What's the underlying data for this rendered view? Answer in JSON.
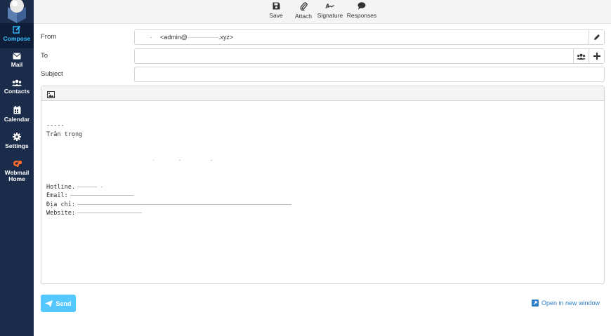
{
  "sidebar": {
    "items": [
      {
        "id": "compose",
        "label": "Compose",
        "icon": "compose-icon"
      },
      {
        "id": "mail",
        "label": "Mail",
        "icon": "envelope-icon"
      },
      {
        "id": "contacts",
        "label": "Contacts",
        "icon": "users-icon"
      },
      {
        "id": "calendar",
        "label": "Calendar",
        "icon": "calendar-icon"
      },
      {
        "id": "settings",
        "label": "Settings",
        "icon": "gear-icon"
      },
      {
        "id": "webmail",
        "label_line1": "Webmail",
        "label_line2": "Home",
        "icon": "cpanel-icon"
      }
    ]
  },
  "toolbar": {
    "save": "Save",
    "attach": "Attach",
    "signature": "Signature",
    "responses": "Responses"
  },
  "form": {
    "from_label": "From",
    "to_label": "To",
    "subject_label": "Subject",
    "from_value_prefix": "<admin@",
    "from_value_suffix": ".xyz>"
  },
  "signature": {
    "separator": "-----",
    "greeting": "Trân trọng",
    "hotline_label": "Hotline.",
    "email_label": "Email:",
    "address_label": "Địa chỉ:",
    "website_label": "Website:"
  },
  "footer": {
    "send_label": "Send",
    "open_window_label": "Open in new window"
  },
  "colors": {
    "sidebar_bg": "#1b2b4a",
    "accent": "#37beff",
    "link": "#2f7fc6",
    "cpanel": "#ff6c2c"
  }
}
